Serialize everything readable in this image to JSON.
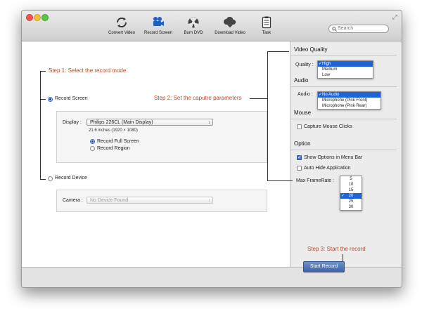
{
  "toolbar": {
    "buttons": [
      {
        "label": "Convert Video",
        "icon": "convert-icon"
      },
      {
        "label": "Record Screen",
        "icon": "record-screen-icon"
      },
      {
        "label": "Burn DVD",
        "icon": "burn-dvd-icon"
      },
      {
        "label": "Download Video",
        "icon": "download-video-icon"
      },
      {
        "label": "Task",
        "icon": "task-icon"
      }
    ],
    "search_placeholder": "Search"
  },
  "steps": {
    "step1_num": "Step 1:",
    "step1_text": "Select the record mode",
    "step2_num": "Step 2:",
    "step2_text": "Set the caputre parameters",
    "step3_num": "Step 3:",
    "step3_text": "Start the record"
  },
  "record_screen": {
    "label": "Record Screen",
    "display_label": "Display :",
    "display_value": "Philips 226CL (Main Display)",
    "display_info": "21.6 inches (1920 × 1080)",
    "opt_full": "Record Full Screen",
    "opt_region": "Record Region"
  },
  "record_device": {
    "label": "Record Device",
    "camera_label": "Camera :",
    "camera_value": "No Device Found"
  },
  "settings": {
    "video_quality_title": "Video Quality",
    "quality_label": "Quality :",
    "quality_options": [
      "High",
      "Medium",
      "Low"
    ],
    "audio_title": "Audio",
    "audio_label": "Audio :",
    "audio_options": [
      "No Audio",
      "Microphone (Pink Front)",
      "Microphone (Pink Rear)"
    ],
    "mouse_title": "Mouse",
    "capture_mouse": "Capture Mouse Clicks",
    "option_title": "Option",
    "show_options": "Show Options in Menu Bar",
    "auto_hide": "Auto Hide Application",
    "framerate_label": "Max FrameRate :",
    "framerate_options": [
      "5",
      "10",
      "15",
      "20",
      "25",
      "30"
    ]
  },
  "start_button": "Start Record",
  "colors": {
    "step_text": "#b24a2c",
    "selection": "#1f63d8",
    "start_button": "#4a6fb0"
  }
}
